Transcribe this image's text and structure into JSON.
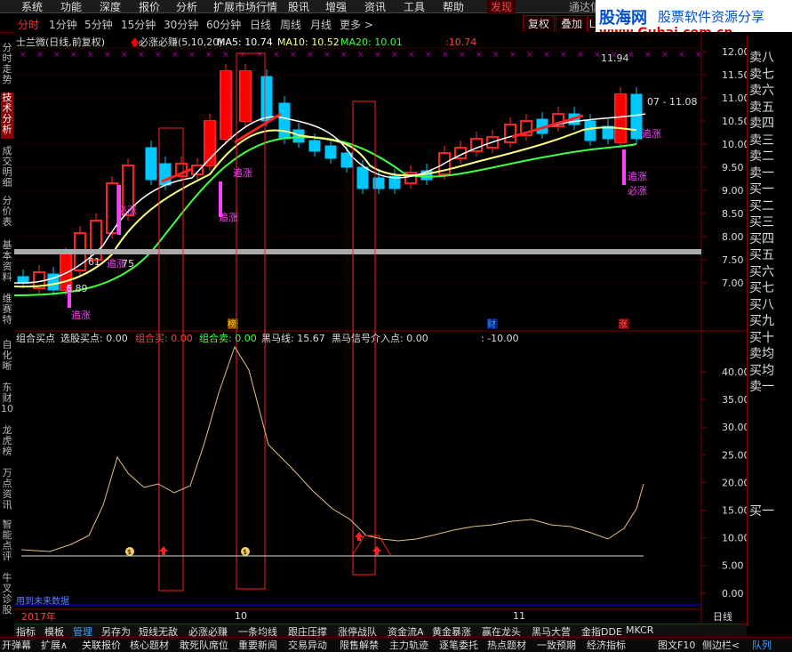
{
  "menubar": {
    "items": [
      "系统",
      "功能",
      "深度",
      "报价",
      "分析",
      "扩展市场行情",
      "股讯",
      "增强",
      "资讯",
      "工具",
      "帮助"
    ],
    "highlight": "发现",
    "system_name": "通达信"
  },
  "period_tabs": [
    "分时",
    "1分钟",
    "5分钟",
    "15分钟",
    "30分钟",
    "60分钟",
    "日线",
    "周线",
    "月线",
    "更多 >"
  ],
  "active_period": "日线",
  "right_buttons": [
    "复权",
    "叠加",
    "L"
  ],
  "logo": {
    "brand": "股海网",
    "slogan": "股票软件资源分享",
    "url": "www.Guhai.com.cn"
  },
  "left_tabs": [
    "分时走势",
    "技术分析",
    "成交明细",
    "分价表",
    "基本资料",
    "维赛特",
    "自化晰",
    "东财10",
    "龙虎榜",
    "万点资讯",
    "智能点评",
    "牛叉诊股"
  ],
  "active_left_tab": "技术分析",
  "order_book": [
    "卖八",
    "卖七",
    "卖六",
    "卖五",
    "卖四",
    "卖三",
    "卖二",
    "卖一",
    "买一",
    "买二",
    "买三",
    "买四",
    "买五",
    "买六",
    "买七",
    "买八",
    "买九",
    "买十",
    "卖均",
    "买均",
    "卖一"
  ],
  "order_book_lower": "买一",
  "price_panel": {
    "title": "士兰微(日线,前复权)",
    "indicator": "必涨必赚(5,10,20)",
    "ma5_label": "MA5: 10.74",
    "ma10_label": "MA10: 10.52",
    "ma20_label": "MA20: 10.01",
    "extra_label": ":10.74",
    "high_label": "11.94",
    "range_label": "07 - 11.08",
    "low_label": "6.89",
    "mid_label1": "61",
    "mid_label2": "75",
    "markers": [
      "榜",
      "财",
      "涨"
    ],
    "signals": [
      "追涨",
      "追涨",
      "必涨",
      "追涨",
      "追涨",
      "追涨",
      "必涨",
      "追涨"
    ],
    "y_ticks": [
      "12.00",
      "11.50",
      "11.00",
      "10.50",
      "10.00",
      "9.50",
      "9.00",
      "8.50",
      "8.00",
      "7.50",
      "7.00"
    ]
  },
  "indicator_panel": {
    "labels": [
      "组合买点",
      "选股买点: 0.00",
      "组合买: 0.00",
      "组合卖: 0.00",
      "黑马线: 15.67",
      "黑马信号介入点: 0.00",
      ": -10.00"
    ],
    "y_ticks": [
      "40.00",
      "35.00",
      "30.00",
      "25.00",
      "20.00",
      "15.00",
      "10.00",
      "5.00",
      "0.00"
    ],
    "future_label": "用到未来数据"
  },
  "x_axis": {
    "labels": [
      "2017年",
      "10",
      "11"
    ],
    "period_label": "日线"
  },
  "bottom_tabs": [
    "指标",
    "模板",
    "管理",
    "另存为",
    "短线无敌",
    "必涨必赚",
    "一条均线",
    "跟庄压撑",
    "涨停战队",
    "资金流A",
    "黄金暴涨",
    "赢在龙头",
    "黑马大营",
    "金指DDE",
    "MKCR"
  ],
  "active_bottom_tab": "管理",
  "footer_tabs": [
    "开弹幕",
    "扩展∧",
    "关联报价",
    "核心题材",
    "敢死队席位",
    "重要新闻",
    "交易异动",
    "限售解禁",
    "主力轨迹",
    "逐笔委托",
    "热点题材",
    "一致预期",
    "经济指标",
    "图文F10",
    "侧边栏<",
    "队列"
  ],
  "colors": {
    "up": "#ff0000",
    "down": "#00c8ff",
    "ma5": "#ffffff",
    "ma10": "#ffff80",
    "ma20": "#40ff40",
    "signal": "#ff40ff",
    "frame": "#7a0000"
  }
}
